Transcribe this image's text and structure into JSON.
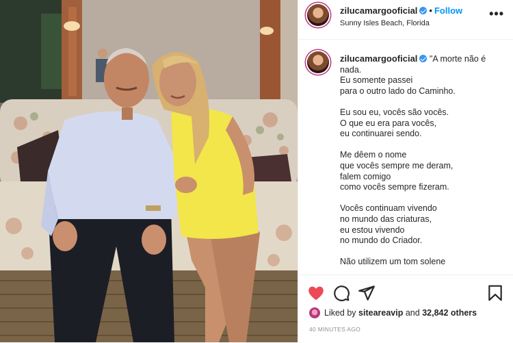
{
  "post": {
    "username": "zilucamargooficial",
    "verified": true,
    "follow_label": "Follow",
    "separator": "•",
    "location": "Sunny Isles Beach, Florida",
    "more_icon": "more-options-icon"
  },
  "caption": {
    "username": "zilucamargooficial",
    "first_line": "\"A morte não é",
    "lines": [
      "nada.",
      "Eu somente passei",
      "para o outro lado do Caminho.",
      "",
      "Eu sou eu, vocês são vocês.",
      "O que eu era para vocês,",
      "eu continuarei sendo.",
      "",
      "Me dêem o nome",
      "que vocês sempre me deram,",
      "falem comigo",
      "como vocês sempre fizeram.",
      "",
      "Vocês continuam vivendo",
      "no mundo das criaturas,",
      "eu estou vivendo",
      "no mundo do Criador.",
      "",
      "Não utilizem um tom solene"
    ]
  },
  "actions": {
    "like_icon": "heart-icon",
    "like_color": "#ed4956",
    "comment_icon": "comment-icon",
    "share_icon": "share-icon",
    "save_icon": "bookmark-icon"
  },
  "likes": {
    "prefix": "Liked by",
    "user": "sitearea vip",
    "user_display": "siteareavip",
    "connector": "and",
    "others": "32,842 others"
  },
  "timestamp": "40 MINUTES AGO",
  "colors": {
    "link_blue": "#0095f6",
    "verified_blue": "#3897f0",
    "sofa_fabric": "#d9cfc0",
    "dress_yellow": "#f2e64a"
  }
}
